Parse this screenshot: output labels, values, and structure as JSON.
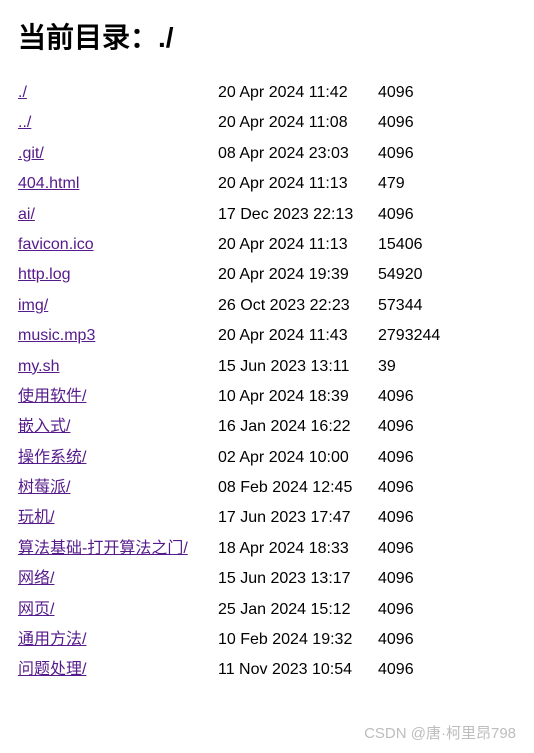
{
  "heading_prefix": "当前目录：",
  "heading_path": "./",
  "entries": [
    {
      "name": "./",
      "date": "20 Apr 2024 11:42",
      "size": "4096"
    },
    {
      "name": "../",
      "date": "20 Apr 2024 11:08",
      "size": "4096"
    },
    {
      "name": ".git/",
      "date": "08 Apr 2024 23:03",
      "size": "4096"
    },
    {
      "name": "404.html",
      "date": "20 Apr 2024 11:13",
      "size": "479"
    },
    {
      "name": "ai/",
      "date": "17 Dec 2023 22:13",
      "size": "4096"
    },
    {
      "name": "favicon.ico",
      "date": "20 Apr 2024 11:13",
      "size": "15406"
    },
    {
      "name": "http.log",
      "date": "20 Apr 2024 19:39",
      "size": "54920"
    },
    {
      "name": "img/",
      "date": "26 Oct 2023 22:23",
      "size": "57344"
    },
    {
      "name": "music.mp3",
      "date": "20 Apr 2024 11:43",
      "size": "2793244"
    },
    {
      "name": "my.sh",
      "date": "15 Jun 2023 13:11",
      "size": "39"
    },
    {
      "name": "使用软件/",
      "date": "10 Apr 2024 18:39",
      "size": "4096"
    },
    {
      "name": "嵌入式/",
      "date": "16 Jan 2024 16:22",
      "size": "4096"
    },
    {
      "name": "操作系统/",
      "date": "02 Apr 2024 10:00",
      "size": "4096"
    },
    {
      "name": "树莓派/",
      "date": "08 Feb 2024 12:45",
      "size": "4096"
    },
    {
      "name": "玩机/",
      "date": "17 Jun 2023 17:47",
      "size": "4096"
    },
    {
      "name": "算法基础-打开算法之门/",
      "date": "18 Apr 2024 18:33",
      "size": "4096"
    },
    {
      "name": "网络/",
      "date": "15 Jun 2023 13:17",
      "size": "4096"
    },
    {
      "name": "网页/",
      "date": "25 Jan 2024 15:12",
      "size": "4096"
    },
    {
      "name": "通用方法/",
      "date": "10 Feb 2024 19:32",
      "size": "4096"
    },
    {
      "name": "问题处理/",
      "date": "11 Nov 2023 10:54",
      "size": "4096"
    }
  ],
  "watermark": "CSDN @唐·柯里昂798"
}
